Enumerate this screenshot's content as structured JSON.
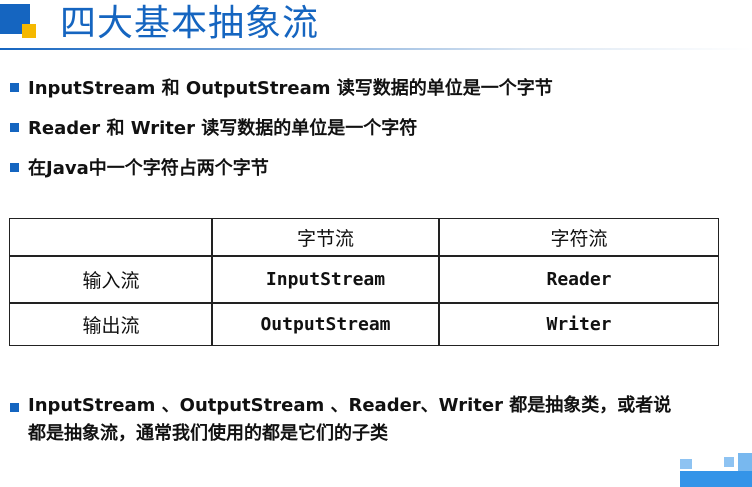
{
  "slide": {
    "title": "四大基本抽象流",
    "accent_color": "#1565c0",
    "highlight_color": "#f5b800"
  },
  "bullets": [
    "InputStream 和 OutputStream 读写数据的单位是一个字节",
    "Reader  和 Writer 读写数据的单位是一个字符",
    "在Java中一个字符占两个字节"
  ],
  "table": {
    "headers": [
      "",
      "字节流",
      "字符流"
    ],
    "rows": [
      [
        "输入流",
        "InputStream",
        "Reader"
      ],
      [
        "输出流",
        "OutputStream",
        "Writer"
      ]
    ]
  },
  "note": {
    "line1": "InputStream 、OutputStream 、Reader、Writer 都是抽象类，或者说",
    "line2": "都是抽象流，通常我们使用的都是它们的子类"
  }
}
